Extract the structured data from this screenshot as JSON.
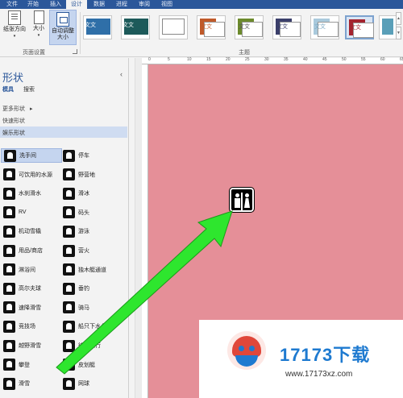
{
  "tabs": [
    "文件",
    "开始",
    "插入",
    "设计",
    "数据",
    "进程",
    "审阅",
    "视图"
  ],
  "active_tab_index": 3,
  "ribbon": {
    "page_setup": {
      "orientation_label": "纸张方向",
      "size_label": "大小",
      "auto_size_label": "自动调整大小",
      "group_label": "页面设置"
    },
    "themes": {
      "group_label": "主题",
      "sample_text": "文文"
    }
  },
  "panel": {
    "title": "形状",
    "sub_tabs": [
      "模具",
      "搜索"
    ],
    "more_shapes": "更多形状",
    "quick_shapes": "快速形状",
    "active_stencil": "娱乐形状",
    "collapse_glyph": "‹",
    "more_arrow": "▸"
  },
  "shapes": [
    {
      "label": "洗手间",
      "highlighted": true
    },
    {
      "label": "停车"
    },
    {
      "label": "可饮用的水源"
    },
    {
      "label": "野营地"
    },
    {
      "label": "水刹滑水"
    },
    {
      "label": "滑冰"
    },
    {
      "label": "RV"
    },
    {
      "label": "码头"
    },
    {
      "label": "机动雪橇"
    },
    {
      "label": "游泳"
    },
    {
      "label": "用品/商店"
    },
    {
      "label": "营火"
    },
    {
      "label": "淋浴间"
    },
    {
      "label": "独木艇通道"
    },
    {
      "label": "高尔夫球"
    },
    {
      "label": "垂钓"
    },
    {
      "label": "速降滑雪"
    },
    {
      "label": "骑马"
    },
    {
      "label": "竞技场"
    },
    {
      "label": "船只下水台"
    },
    {
      "label": "越野滑雪"
    },
    {
      "label": "徒步旅行"
    },
    {
      "label": "攀登"
    },
    {
      "label": "皮划艇"
    },
    {
      "label": "滑雪"
    },
    {
      "label": "网球"
    }
  ],
  "ruler_ticks": [
    "0",
    "5",
    "10",
    "15",
    "20",
    "25",
    "30",
    "35",
    "40",
    "45",
    "50",
    "55",
    "60",
    "65"
  ],
  "watermark": {
    "brand_digits": "17173",
    "brand_cn": "下载",
    "url": "www.17173xz.com"
  },
  "colors": {
    "tab_bar": "#2b579a",
    "canvas": "#e58f98",
    "arrow": "#2ee62e",
    "brand": "#1e7ad0"
  }
}
